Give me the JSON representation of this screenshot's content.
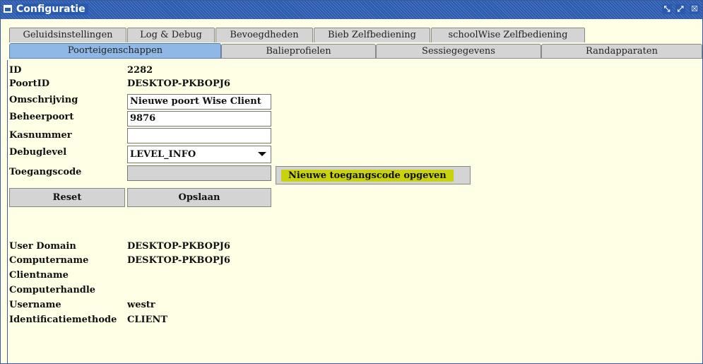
{
  "window": {
    "title": "Configuratie"
  },
  "tabs_row1": [
    "Geluidsinstellingen",
    "Log & Debug",
    "Bevoegdheden",
    "Bieb Zelfbediening",
    "schoolWise Zelfbediening"
  ],
  "tabs_row2": [
    "Poorteigenschappen",
    "Balieprofielen",
    "Sessiegegevens",
    "Randapparaten"
  ],
  "active_tab": "Poorteigenschappen",
  "form": {
    "id_label": "ID",
    "id_value": "2282",
    "poortid_label": "PoortID",
    "poortid_value": "DESKTOP-PKBOPJ6",
    "omschrijving_label": "Omschrijving",
    "omschrijving_value": "Nieuwe poort Wise Client",
    "beheerpoort_label": "Beheerpoort",
    "beheerpoort_value": "9876",
    "kasnummer_label": "Kasnummer",
    "kasnummer_value": "",
    "debuglevel_label": "Debuglevel",
    "debuglevel_value": "LEVEL_INFO",
    "toegangscode_label": "Toegangscode",
    "toegangscode_value": "",
    "new_code_button": "Nieuwe toegangscode opgeven",
    "reset_button": "Reset",
    "save_button": "Opslaan"
  },
  "info": {
    "user_domain_label": "User Domain",
    "user_domain_value": "DESKTOP-PKBOPJ6",
    "computername_label": "Computername",
    "computername_value": "DESKTOP-PKBOPJ6",
    "clientname_label": "Clientname",
    "clientname_value": "",
    "computerhandle_label": "Computerhandle",
    "computerhandle_value": "",
    "username_label": "Username",
    "username_value": "westr",
    "identificatie_label": "Identificatiemethode",
    "identificatie_value": "CLIENT"
  },
  "colors": {
    "titlebar": "#2a5ab0",
    "background": "#ffffe6",
    "active_tab": "#8fb8e6",
    "highlight": "#c9d20a"
  },
  "icons": {
    "window_icon": "window-icon",
    "restore": "restore-icon",
    "maximize": "maximize-icon",
    "close": "close-icon"
  }
}
